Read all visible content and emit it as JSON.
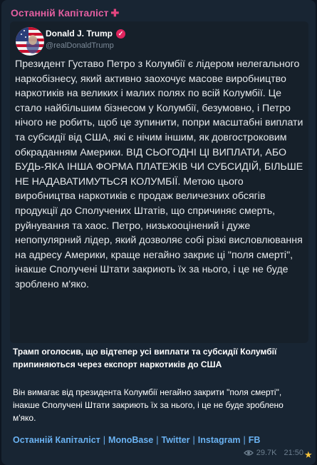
{
  "channel": {
    "name": "Останній Капіталіст",
    "plus_icon": "✚"
  },
  "post": {
    "author": "Donald J. Trump",
    "handle": "@realDonaldTrump",
    "paragraphs": [
      "Президент Густаво Петро з Колумбії є лідером нелегального наркобізнесу, який активно заохочує масове виробництво наркотиків на великих і малих полях по всій Колумбії. Це стало найбільшим бізнесом у Колумбії, безумовно, і Петро нічого не робить, щоб це зупинити, попри масштабні виплати та субсидії від США, які є нічим іншим, як довгостроковим обкраданням Америки. ВІД СЬОГОДНІ ЦІ ВИПЛАТИ, АБО БУДЬ-ЯКА ІНША ФОРМА ПЛАТЕЖІВ ЧИ СУБСИДІЙ, БІЛЬШЕ НЕ НАДАВАТИМУТЬСЯ КОЛУМБІЇ. Метою цього виробництва наркотиків є продаж величезних обсягів продукції до Сполучених Штатів, що спричиняє смерть, руйнування та хаос. Петро, низькооцінений і дуже непопулярний лідер, який дозволяє собі різкі висловлювання на адресу Америки, краще негайно закриє ці \"поля смерті\", інакше Сполучені Штати закриють їх за нього, і це не буде зроблено м'яко."
    ]
  },
  "headline": "Трамп оголосив, що відтепер усі виплати та субсидії Колумбії припиняються через експорт наркотиків до США",
  "subtext": "Він вимагає від президента Колумбії негайно закрити \"поля смерті\", інакше Сполучені Штати закриють їх за нього, і це не буде зроблено м'яко.",
  "links": {
    "items": [
      "Останній Капіталіст",
      "MonoBase",
      "Twitter",
      "Instagram",
      "FB"
    ],
    "separator": "|"
  },
  "meta": {
    "views": "29.7K",
    "time": "21:50"
  },
  "icons": {
    "avatar": "flag-portrait-avatar",
    "verified": "verified-badge-icon",
    "views": "eye-icon",
    "reaction": "star-icon"
  },
  "colors": {
    "background": "#0e1621",
    "bubble": "#182533",
    "channel_name": "#e25fa0",
    "link": "#6ab2f2",
    "meta": "#6d7f8f"
  }
}
